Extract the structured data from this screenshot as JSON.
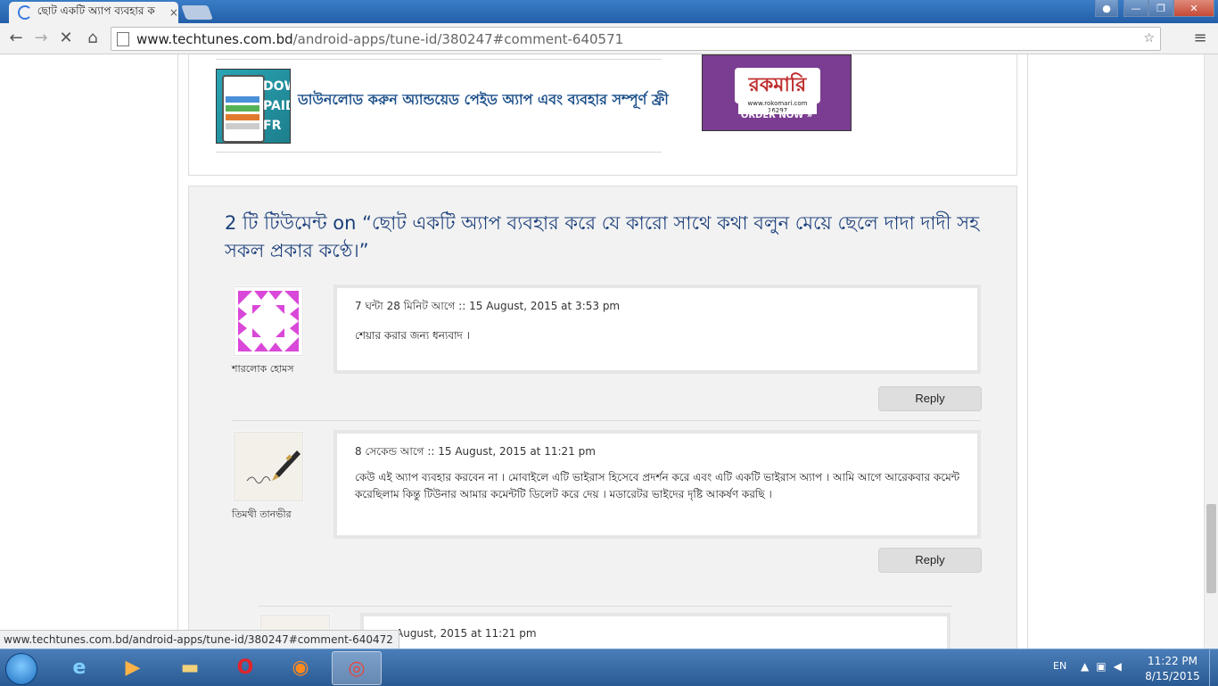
{
  "browser": {
    "tab_title": "ছোট একটি অ্যাপ ব্যবহার ক",
    "tab_close": "×",
    "url_host": "www.techtunes.com.bd",
    "url_path": "/android-apps/tune-id/380247#comment-640571",
    "back": "←",
    "forward": "→",
    "stop": "✕",
    "home": "⌂",
    "menu": "≡",
    "star": "☆",
    "win_minimize": "—",
    "win_maximize": "❐",
    "win_close": "✕"
  },
  "related": {
    "title": "ডাউনলোড করুন অ্যান্ডয়েড পেইড অ্যাপ এবং ব্যবহার সম্পূর্ণ ফ্রী",
    "thumb_text": "DOW PAID FR"
  },
  "ad": {
    "logo": "রকমারি",
    "small": "www.rokomari.com  16297",
    "order": "ORDER NOW »"
  },
  "comments_section": {
    "title": "2 টি টিউমেন্ট on “ছোট একটি অ্যাপ ব্যবহার করে যে কারো সাথে কথা বলুন মেয়ে ছেলে দাদা দাদী সহ সকল প্রকার কণ্ঠে।”"
  },
  "comments": [
    {
      "author": "শারলোক হোমস",
      "meta": "7 ঘন্টা 28 মিনিট আগে :: 15 August, 2015 at 3:53 pm",
      "text": "শেয়ার করার জন্য ধন্যবাদ ।",
      "reply": "Reply"
    },
    {
      "author": "তিমথী তানভীর",
      "meta": "8 সেকেন্ড আগে :: 15 August, 2015 at 11:21 pm",
      "text": "কেউ এই অ্যাপ ব্যবহার করবেন না । মোবাইলে এটি ভাইরাস হিসেবে প্রদর্শন করে এবং এটি একটি ভাইরাস অ্যাপ । আমি আগে আরেকবার কমেন্ট করেছিলাম কিন্তু টিউনার আমার কমেন্টটি ডিলেট করে দেয় । মডারেটর ভাইদের দৃষ্টি আকর্ষণ করছি ।",
      "reply": "Reply"
    },
    {
      "meta": "August, 2015 at 11:21 pm"
    }
  ],
  "status_bar": "www.techtunes.com.bd/android-apps/tune-id/380247#comment-640472",
  "taskbar": {
    "lang": "EN",
    "time": "11:22 PM",
    "date": "8/15/2015"
  }
}
